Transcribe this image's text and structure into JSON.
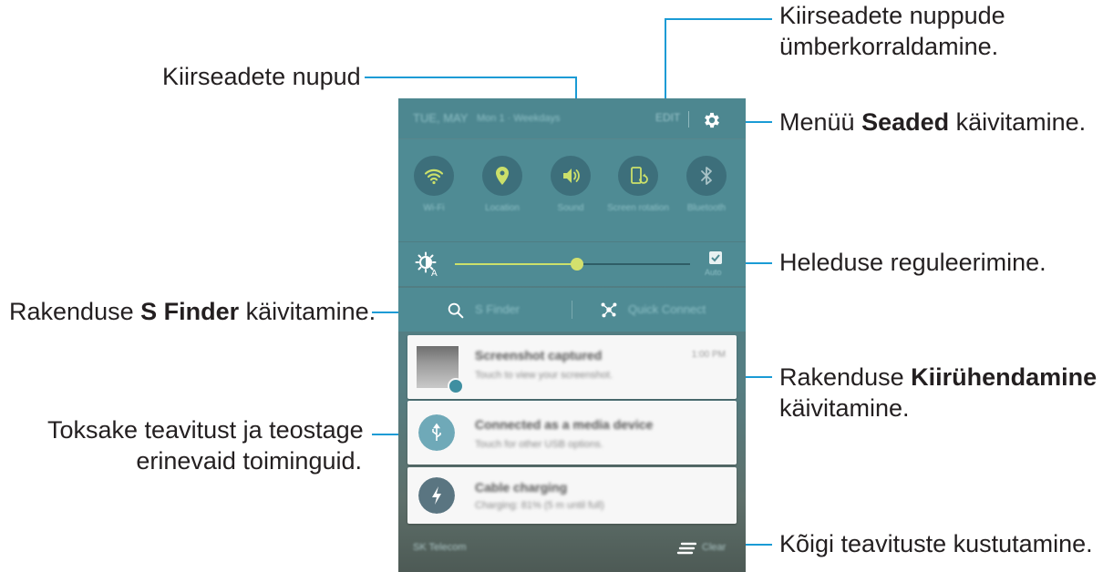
{
  "annotations": {
    "rearrange": {
      "line1": "Kiirseadete nuppude",
      "line2": "ümberkorraldamine."
    },
    "settings": {
      "prefix": "Menüü ",
      "bold": "Seaded",
      "suffix": " käivitamine."
    },
    "quick_buttons": "Kiirseadete nupud",
    "brightness": "Heleduse reguleerimine.",
    "s_finder": {
      "prefix": "Rakenduse ",
      "bold": "S Finder",
      "suffix": " käivitamine."
    },
    "quick_connect": {
      "prefix": "Rakenduse ",
      "bold": "Kiirühendamine",
      "line2": "käivitamine."
    },
    "notification": {
      "line1": "Toksake teavitust ja teostage",
      "line2": "erinevaid toiminguid."
    },
    "clear_all": "Kõigi teavituste kustutamine."
  },
  "phone": {
    "status": {
      "time": "TUE, MAY",
      "date": "Mon 1 · Weekdays",
      "edit": "EDIT"
    },
    "quick_settings": [
      {
        "icon": "wifi-icon",
        "label": "Wi-Fi",
        "active": true
      },
      {
        "icon": "location-icon",
        "label": "Location",
        "active": true
      },
      {
        "icon": "sound-icon",
        "label": "Sound",
        "active": true
      },
      {
        "icon": "screen-rotation-icon",
        "label": "Screen rotation",
        "active": true
      },
      {
        "icon": "bluetooth-icon",
        "label": "Bluetooth",
        "active": false
      }
    ],
    "brightness": {
      "level": 0.52,
      "auto_label": "Auto",
      "auto_checked": true
    },
    "finder": {
      "s_finder": "S Finder",
      "quick_connect": "Quick Connect"
    },
    "notifications": [
      {
        "title": "Screenshot captured",
        "subtitle": "Touch to view your screenshot.",
        "time": "1:00 PM"
      },
      {
        "title": "Connected as a media device",
        "subtitle": "Touch for other USB options."
      },
      {
        "title": "Cable charging",
        "subtitle": "Charging: 81% (5 m until full)"
      }
    ],
    "bottom": {
      "carrier": "SK Telecom",
      "clear": "Clear"
    }
  },
  "colors": {
    "accent_line": "#1a9bd5",
    "qs_active": "#cbe06a",
    "panel": "#4f8b94"
  }
}
